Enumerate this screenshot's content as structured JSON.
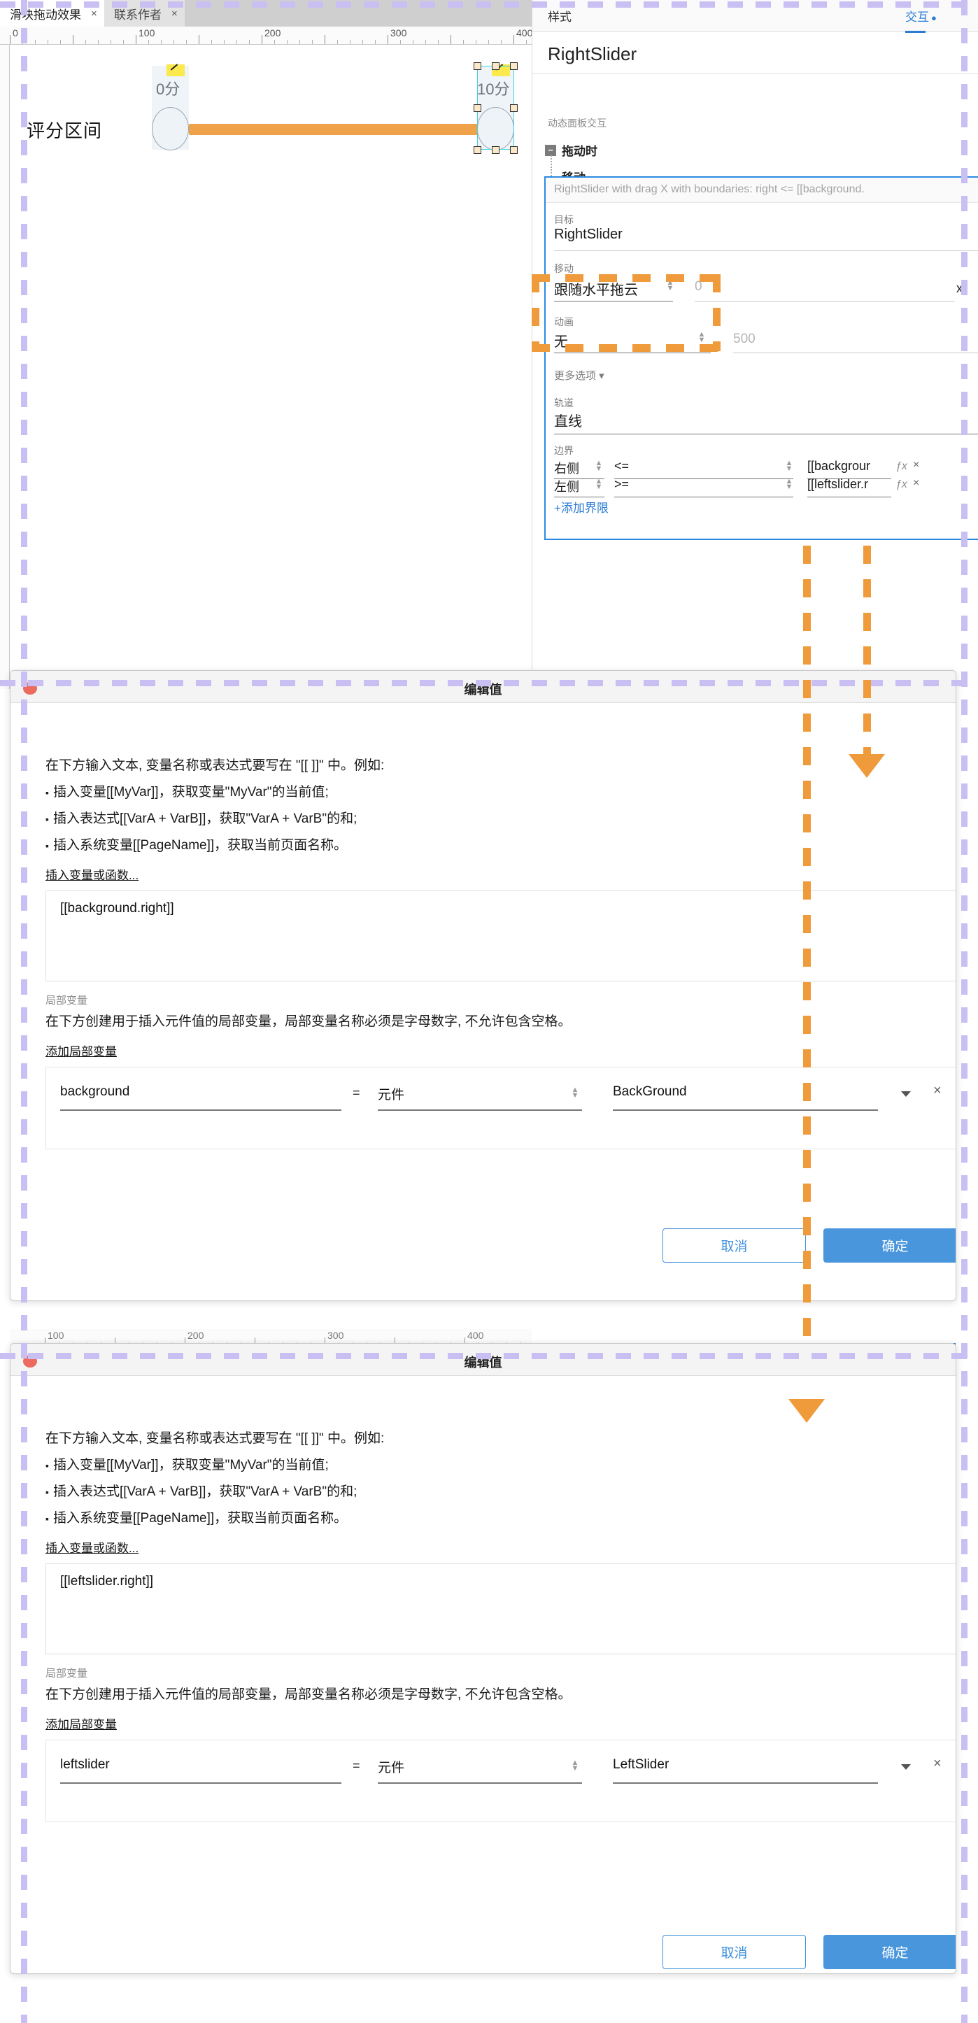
{
  "editor": {
    "tabs": [
      {
        "label": "滑块拖动效果",
        "close": "×",
        "active": true
      },
      {
        "label": "联系作者",
        "close": "×",
        "active": false
      }
    ],
    "ruler": {
      "numbers": [
        "0",
        "100",
        "200",
        "300",
        "400"
      ]
    },
    "canvas": {
      "section_label": "评分区间",
      "left_knob_text": "0分",
      "right_knob_text": "10分"
    }
  },
  "properties": {
    "tabs": {
      "style": "样式",
      "interactions": "交互",
      "dot": "●"
    },
    "widget_name": "RightSlider",
    "section_label": "动态面板交互",
    "event_name": "拖动时",
    "action_name": "移动",
    "case_summary": "RightSlider with drag X  with boundaries: right <= [[background.",
    "target_label": "目标",
    "target_value": "RightSlider",
    "move_label": "移动",
    "move_value": "跟随水平拖云",
    "move_offset_placeholder": "0",
    "move_unit": "x",
    "anim_label": "动画",
    "anim_value": "无",
    "anim_duration_placeholder": "500",
    "more_options": "更多选项",
    "track_label": "轨道",
    "track_value": "直线",
    "bounds_label": "边界",
    "bounds": [
      {
        "side": "右侧",
        "op": "<=",
        "value": "[[backgrour"
      },
      {
        "side": "左侧",
        "op": ">=",
        "value": "[[leftslider.r"
      }
    ],
    "add_bound": "+添加界限",
    "fx_label": "ƒx",
    "close_label": "×"
  },
  "dialog1": {
    "title": "编辑值",
    "intro": "在下方输入文本, 变量名称或表达式要写在 \"[[ ]]\" 中。例如:",
    "bullets": [
      "插入变量[[MyVar]]，获取变量\"MyVar\"的当前值;",
      "插入表达式[[VarA + VarB]]，获取\"VarA + VarB\"的和;",
      "插入系统变量[[PageName]]，获取当前页面名称。"
    ],
    "insert_link": "插入变量或函数...",
    "expression": "[[background.right]]",
    "local_var_label": "局部变量",
    "local_var_desc": "在下方创建用于插入元件值的局部变量，局部变量名称必须是字母数字, 不允许包含空格。",
    "add_local_var": "添加局部变量",
    "var_row": {
      "name": "background",
      "equals": "=",
      "type": "元件",
      "target": "BackGround",
      "remove": "×"
    },
    "cancel": "取消",
    "confirm": "确定"
  },
  "dialog2": {
    "title": "编辑值",
    "intro": "在下方输入文本, 变量名称或表达式要写在 \"[[ ]]\" 中。例如:",
    "bullets": [
      "插入变量[[MyVar]]，获取变量\"MyVar\"的当前值;",
      "插入表达式[[VarA + VarB]]，获取\"VarA + VarB\"的和;",
      "插入系统变量[[PageName]]，获取当前页面名称。"
    ],
    "insert_link": "插入变量或函数...",
    "expression": "[[leftslider.right]]",
    "local_var_label": "局部变量",
    "local_var_desc": "在下方创建用于插入元件值的局部变量，局部变量名称必须是字母数字, 不允许包含空格。",
    "add_local_var": "添加局部变量",
    "var_row": {
      "name": "leftslider",
      "equals": "=",
      "type": "元件",
      "target": "LeftSlider",
      "remove": "×"
    },
    "cancel": "取消",
    "confirm": "确定"
  },
  "mini_ruler": {
    "numbers": [
      "100",
      "200",
      "300",
      "400"
    ]
  },
  "colors": {
    "accent_blue": "#2b7cd3",
    "primary_button": "#4a96dd",
    "annotation_orange": "#ef9b3c",
    "annotation_purple": "#c9bff2",
    "slider_track": "#efa24a",
    "selection_cyan": "#3fd0e0"
  }
}
